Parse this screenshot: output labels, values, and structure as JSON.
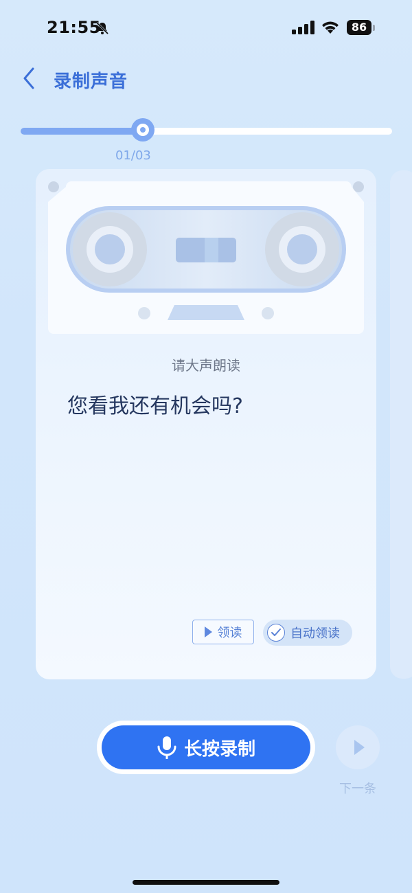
{
  "status_bar": {
    "time": "21:55",
    "battery": "86"
  },
  "header": {
    "title": "录制声音"
  },
  "progress": {
    "label": "01/03",
    "fraction": 0.33
  },
  "card": {
    "prompt": "请大声朗读",
    "sentence": "您看我还有机会吗?",
    "read_button": "领读",
    "auto_read_button": "自动领读"
  },
  "record": {
    "label": "长按录制"
  },
  "next": {
    "label": "下一条"
  },
  "colors": {
    "accent": "#2f73f2",
    "title": "#3b6fd8",
    "progress": "#7fa8f2"
  },
  "icons": [
    "bell-slash-icon",
    "signal-icon",
    "wifi-icon",
    "back-icon",
    "cassette-icon",
    "play-icon",
    "check-icon",
    "microphone-icon",
    "next-play-icon"
  ]
}
